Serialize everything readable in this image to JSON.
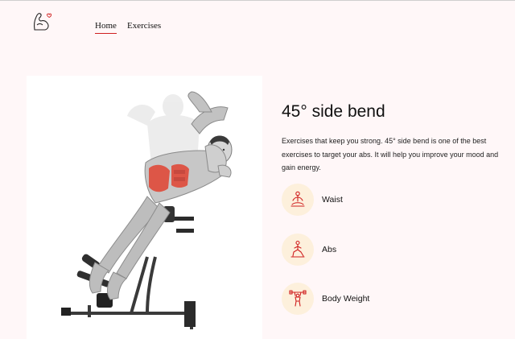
{
  "nav": {
    "home_label": "Home",
    "exercises_label": "Exercises"
  },
  "exercise": {
    "title": "45° side bend",
    "description": "Exercises that keep you strong. 45° side bend is one of the best exercises to target your abs. It will help you improve your mood and gain energy.",
    "image_icon": "exercise-illustration"
  },
  "tags": [
    {
      "label": "Waist",
      "icon": "meditation-pose-icon"
    },
    {
      "label": "Abs",
      "icon": "lunge-pose-icon"
    },
    {
      "label": "Body Weight",
      "icon": "dumbbell-lift-icon"
    }
  ],
  "colors": {
    "background": "#fff7f8",
    "accent": "#d02020",
    "tag_circle": "#fdf0dc",
    "muscle_highlight": "#e04a3a"
  }
}
